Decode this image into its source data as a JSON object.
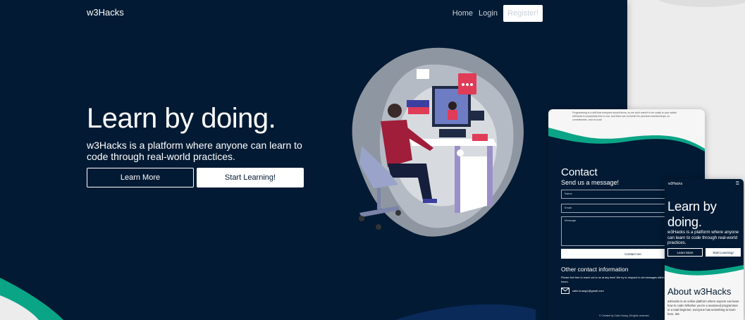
{
  "desktop": {
    "brand": "w3Hacks",
    "nav": {
      "home": "Home",
      "login": "Login",
      "register": "Register!"
    },
    "hero": {
      "heading": "Learn by doing.",
      "subheading": "w3Hacks is a platform where anyone can learn to code through real-world practices.",
      "learn_more": "Learn More",
      "start_learning": "Start Learning!"
    }
  },
  "tablet": {
    "intro_text": "Programming is a skill that everyone should know, so we don't want it to be costly to your wallet. w3Hacks is completely free to use, and there are no limits! No premium memberships, no commitments, and no cost!",
    "contact_title": "Contact",
    "send_message": "Send us a message!",
    "form": {
      "name_placeholder": "Name",
      "email_placeholder": "Email",
      "message_placeholder": "Message",
      "submit": "Contact Us!"
    },
    "other_title": "Other contact information",
    "other_text": "Please feel free to reach out to us at any time! We try to respond to all messages within 24-48 hours.",
    "email": "calix.huang1@gmail.com",
    "footer": "© Created by Calix Huang. All rights reserved."
  },
  "phone": {
    "brand": "w3Hacks",
    "menu_icon": "☰",
    "heading": "Learn by doing.",
    "subheading": "w3Hacks is a platform where anyone can learn to code through real-world practices.",
    "learn_more": "Learn More",
    "start_learning": "Start Learning!",
    "about_title": "About w3Hacks",
    "about_text": "w3Hacks is an online platform where anyone can learn how to code! Whether you're a seasoned programmer or a total beginner, everyone has something to learn here. We"
  },
  "colors": {
    "navy": "#021a33",
    "teal": "#0aa586",
    "white": "#ffffff",
    "accent_red": "#e03b57"
  }
}
